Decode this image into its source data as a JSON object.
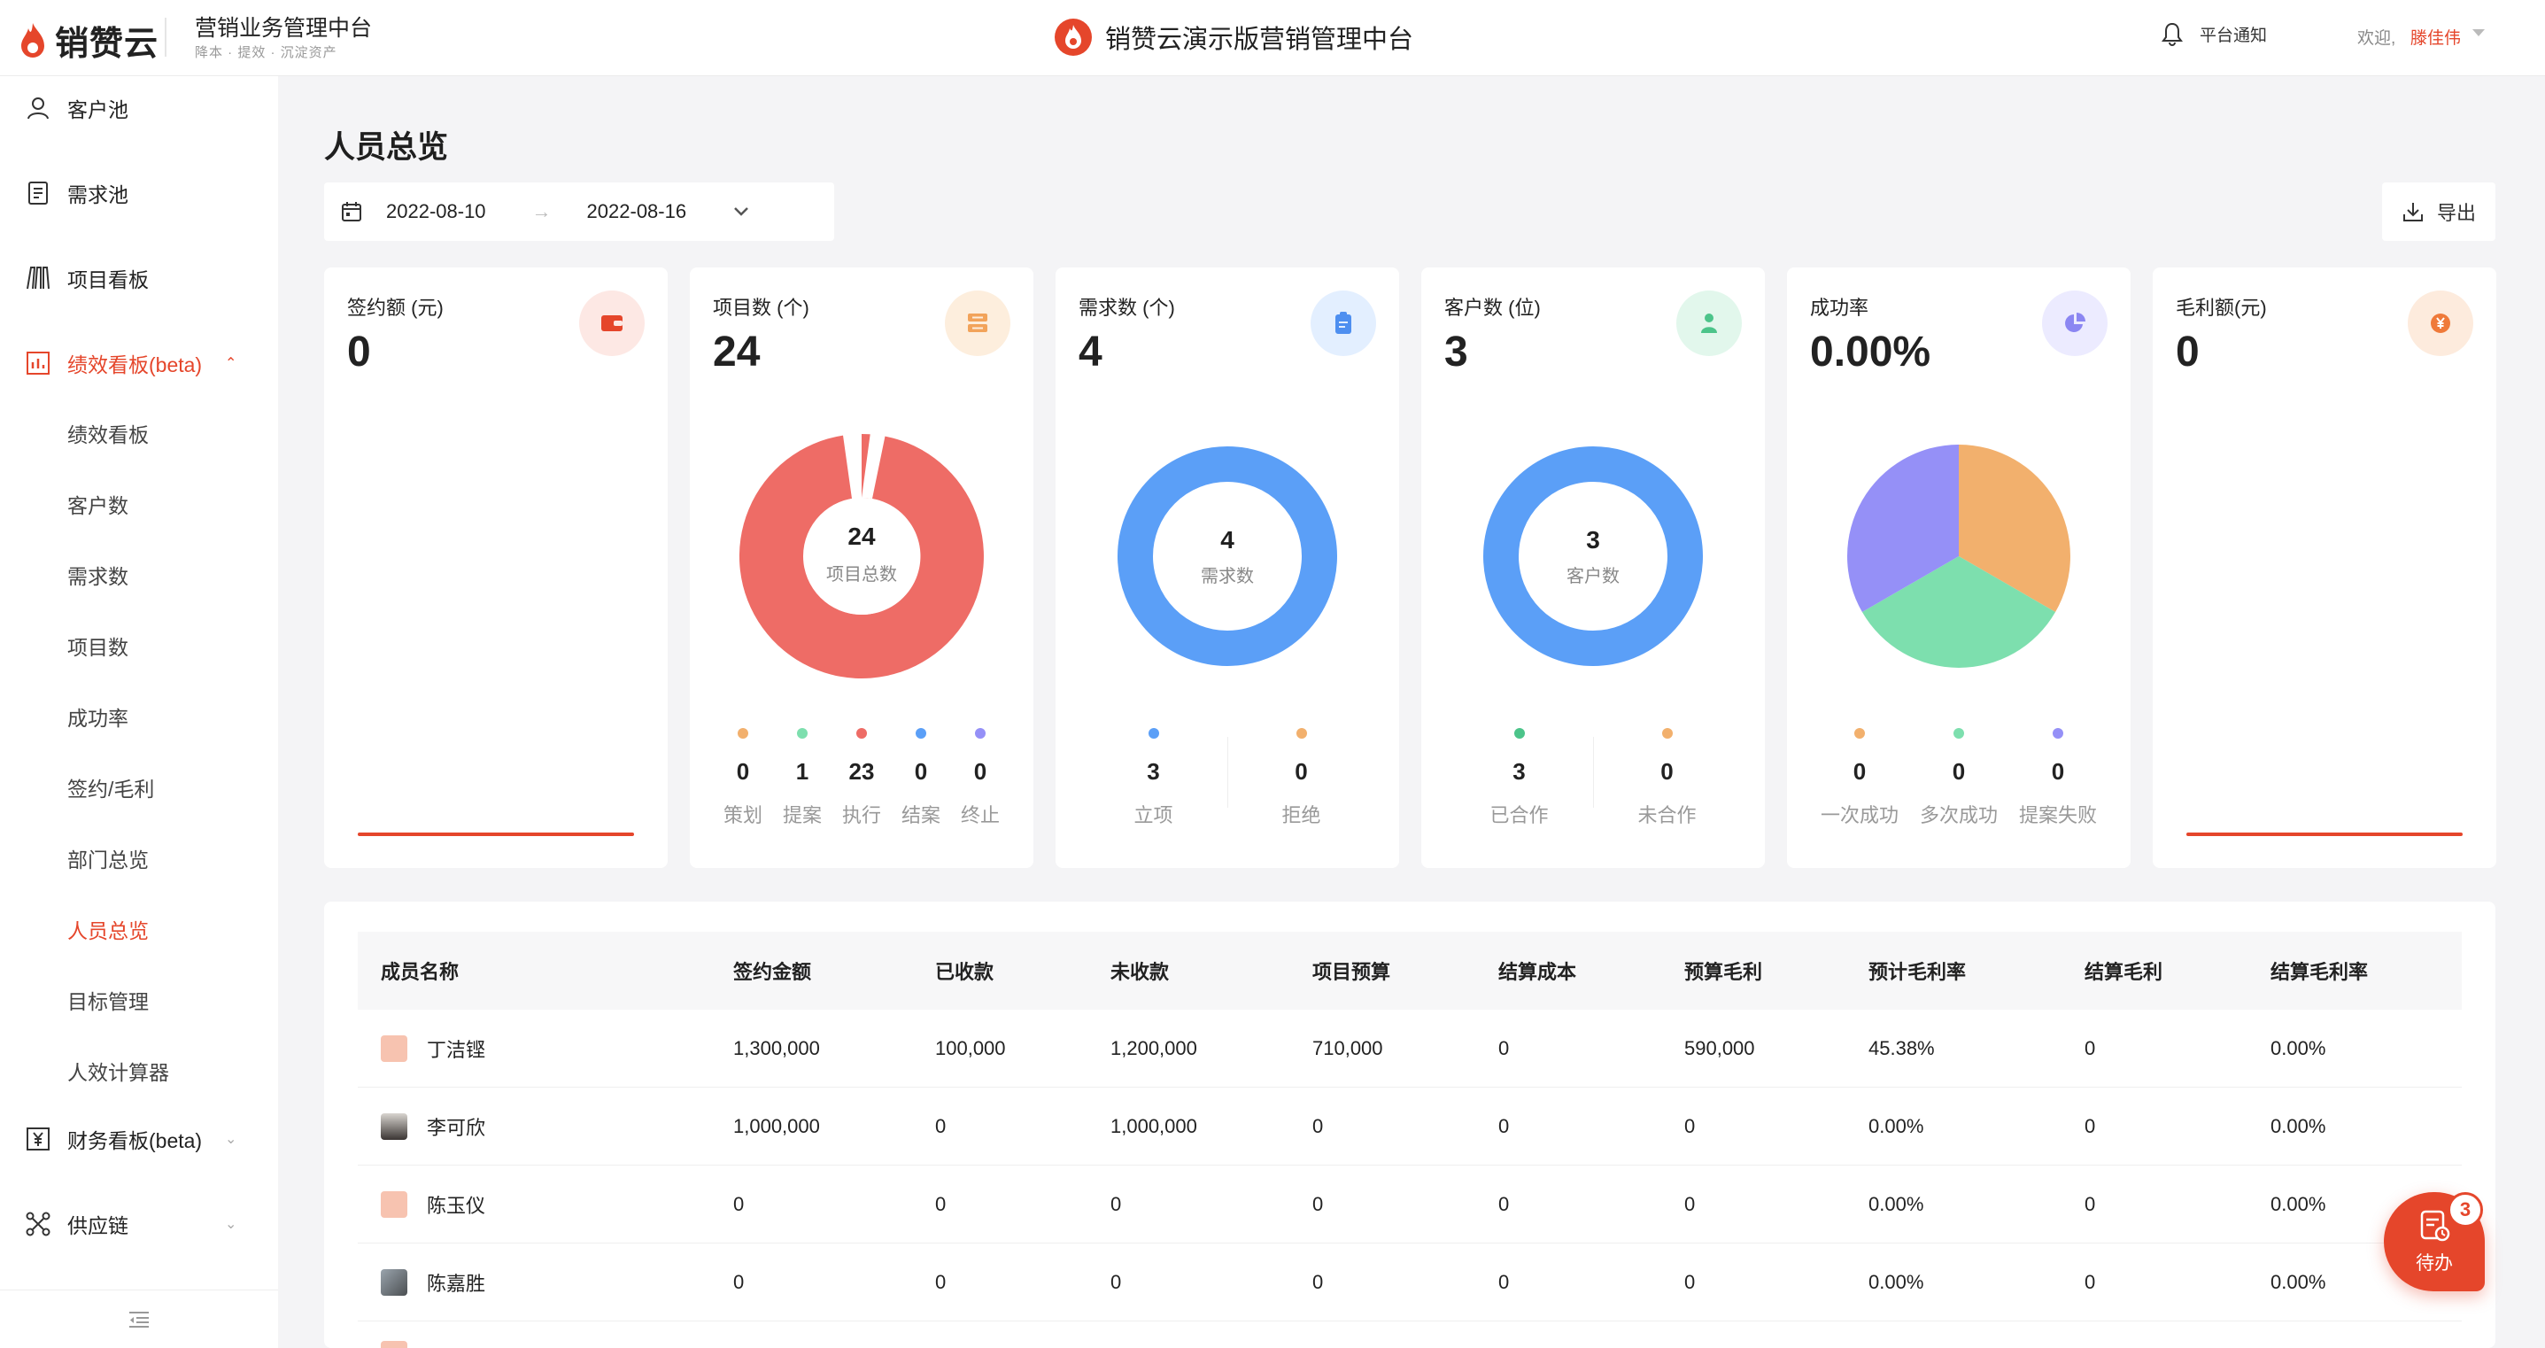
{
  "header": {
    "logo_text": "销赞云",
    "system_title": "营销业务管理中台",
    "system_subtitle": "降本 · 提效 · 沉淀资产",
    "center_title": "销赞云演示版营销管理中台",
    "notify_label": "平台通知",
    "welcome": "欢迎,",
    "username": "滕佳伟"
  },
  "sidebar": {
    "items": [
      {
        "label": "客户池",
        "icon": "user-icon"
      },
      {
        "label": "需求池",
        "icon": "document-icon"
      },
      {
        "label": "项目看板",
        "icon": "board-icon"
      },
      {
        "label": "绩效看板(beta)",
        "icon": "bar-chart-icon"
      },
      {
        "label": "财务看板(beta)",
        "icon": "yen-icon"
      },
      {
        "label": "供应链",
        "icon": "network-icon"
      }
    ],
    "sub_items": [
      "绩效看板",
      "客户数",
      "需求数",
      "项目数",
      "成功率",
      "签约/毛利",
      "部门总览",
      "人员总览",
      "目标管理",
      "人效计算器"
    ],
    "active_sub": "人员总览"
  },
  "page": {
    "title": "人员总览",
    "date_start": "2022-08-10",
    "date_end": "2022-08-16",
    "export_label": "导出"
  },
  "colors": {
    "accent": "#e5462b",
    "orange": "#f2b06d",
    "green": "#7ddfae",
    "red": "#ee6c66",
    "blue": "#5b9ff7",
    "purple": "#9590f7"
  },
  "cards": [
    {
      "title": "签约额 (元)",
      "value": "0"
    },
    {
      "title": "项目数 (个)",
      "value": "24",
      "center_num": "24",
      "center_label": "项目总数",
      "legend": [
        {
          "value": "0",
          "label": "策划"
        },
        {
          "value": "1",
          "label": "提案"
        },
        {
          "value": "23",
          "label": "执行"
        },
        {
          "value": "0",
          "label": "结案"
        },
        {
          "value": "0",
          "label": "终止"
        }
      ]
    },
    {
      "title": "需求数 (个)",
      "value": "4",
      "center_num": "4",
      "center_label": "需求数",
      "legend": [
        {
          "value": "3",
          "label": "立项"
        },
        {
          "value": "0",
          "label": "拒绝"
        }
      ]
    },
    {
      "title": "客户数 (位)",
      "value": "3",
      "center_num": "3",
      "center_label": "客户数",
      "legend": [
        {
          "value": "3",
          "label": "已合作"
        },
        {
          "value": "0",
          "label": "未合作"
        }
      ]
    },
    {
      "title": "成功率",
      "value": "0.00%",
      "legend": [
        {
          "value": "0",
          "label": "一次成功"
        },
        {
          "value": "0",
          "label": "多次成功"
        },
        {
          "value": "0",
          "label": "提案失败"
        }
      ]
    },
    {
      "title": "毛利额(元)",
      "value": "0"
    }
  ],
  "table": {
    "headers": [
      "成员名称",
      "签约金额",
      "已收款",
      "未收款",
      "项目预算",
      "结算成本",
      "预算毛利",
      "预计毛利率",
      "结算毛利",
      "结算毛利率"
    ],
    "rows": [
      [
        "丁洁铿",
        "1,300,000",
        "100,000",
        "1,200,000",
        "710,000",
        "0",
        "590,000",
        "45.38%",
        "0",
        "0.00%"
      ],
      [
        "李可欣",
        "1,000,000",
        "0",
        "1,000,000",
        "0",
        "0",
        "0",
        "0.00%",
        "0",
        "0.00%"
      ],
      [
        "陈玉仪",
        "0",
        "0",
        "0",
        "0",
        "0",
        "0",
        "0.00%",
        "0",
        "0.00%"
      ],
      [
        "陈嘉胜",
        "0",
        "0",
        "0",
        "0",
        "0",
        "0",
        "0.00%",
        "0",
        "0.00%"
      ]
    ]
  },
  "todo": {
    "label": "待办",
    "count": "3"
  }
}
